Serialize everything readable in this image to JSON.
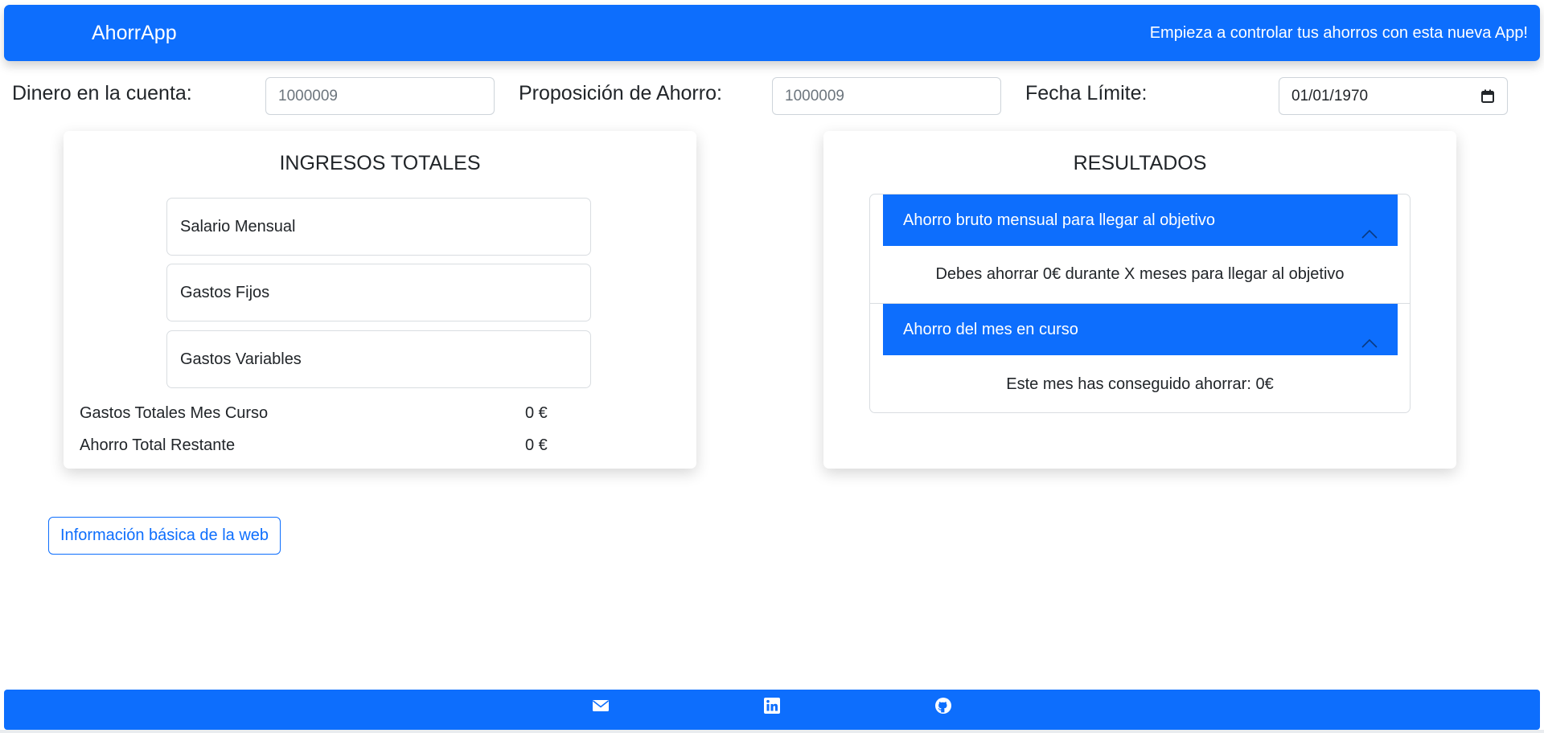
{
  "navbar": {
    "brand": "AhorrApp",
    "tagline": "Empieza a controlar tus ahorros con esta nueva App!"
  },
  "fields": {
    "balance_label": "Dinero en la cuenta:",
    "balance_placeholder": "1000009",
    "proposal_label": "Proposición de Ahorro:",
    "proposal_placeholder": "1000009",
    "deadline_label": "Fecha Límite:",
    "deadline_value": "01/01/1970"
  },
  "income_card": {
    "title": "INGRESOS TOTALES",
    "items": [
      "Salario Mensual",
      "Gastos Fijos",
      "Gastos Variables"
    ],
    "summary": [
      {
        "label": "Gastos Totales Mes Curso",
        "value": "0 €"
      },
      {
        "label": "Ahorro Total Restante",
        "value": "0 €"
      }
    ]
  },
  "results_card": {
    "title": "RESULTADOS",
    "accordion": [
      {
        "header": "Ahorro bruto mensual para llegar al objetivo",
        "body": "Debes ahorrar 0€ durante X meses para llegar al objetivo"
      },
      {
        "header": "Ahorro del mes en curso",
        "body": "Este mes has conseguido ahorrar: 0€"
      }
    ]
  },
  "info_button_label": "Información básica de la web",
  "footer": {
    "icons": [
      "envelope-icon",
      "linkedin-icon",
      "github-icon"
    ]
  },
  "colors": {
    "primary": "#0d6efd",
    "border": "#d9dde1",
    "text": "#212529"
  }
}
